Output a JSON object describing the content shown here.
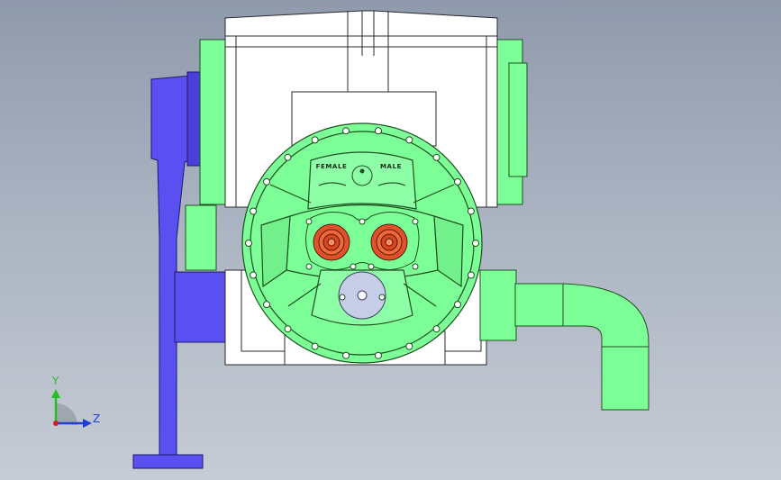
{
  "viewport": {
    "background_top": "#8f9aac",
    "background_bottom": "#c6ccd5"
  },
  "model": {
    "housing_color": "#ffffff",
    "flange_color": "#7dff98",
    "base_color": "#5a4ff0",
    "rotor_color": "#e0522a",
    "hub_color": "#c6cde6",
    "rotor_labels": {
      "female": "FEMALE",
      "male": "MALE"
    }
  },
  "triad": {
    "y_label": "Y",
    "z_label": "Z",
    "y_color": "#1ec41e",
    "z_color": "#1f3fd8",
    "x_color": "#d01e1e"
  }
}
